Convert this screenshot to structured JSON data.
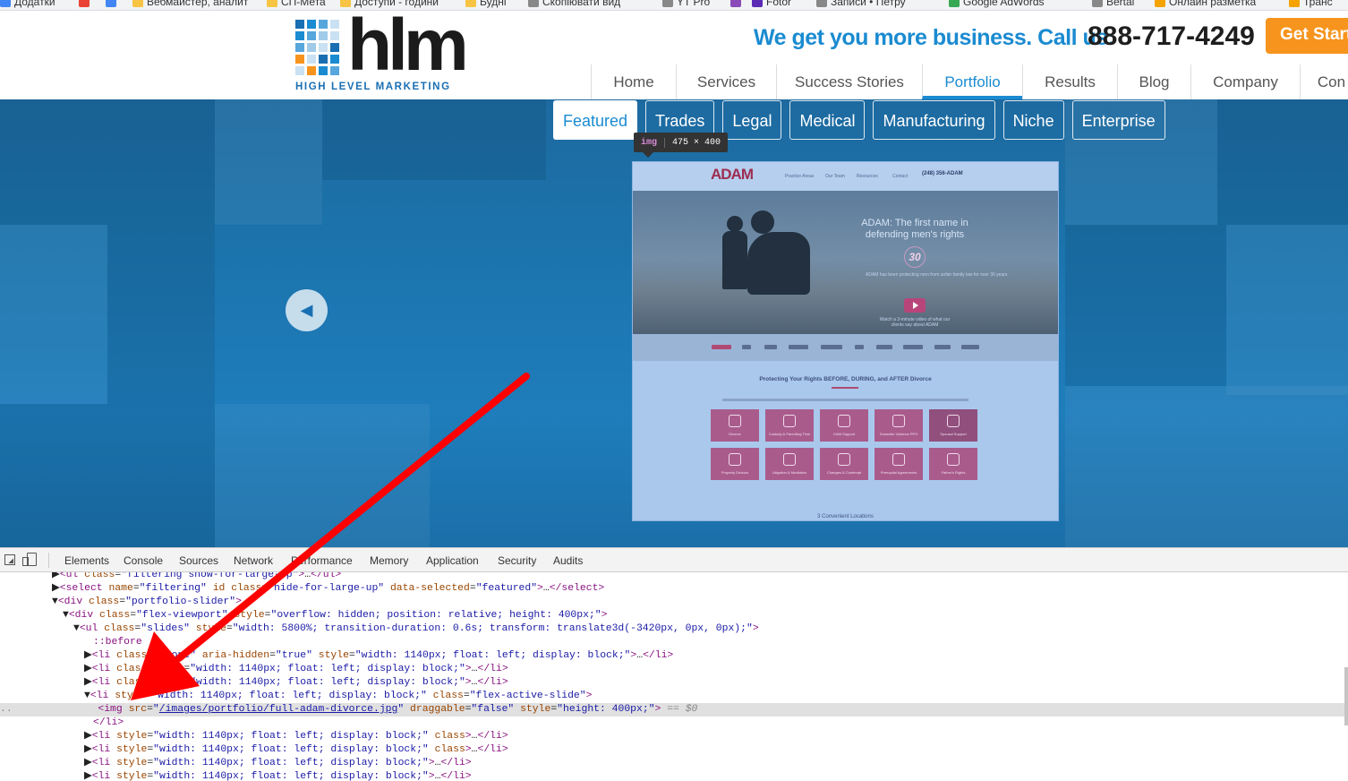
{
  "bookmarks": [
    {
      "label": "Додатки",
      "color": "#4285f4"
    },
    {
      "label": "",
      "color": "#ea4335"
    },
    {
      "label": "",
      "color": "#4285f4"
    },
    {
      "label": "Вебмайстер, аналит",
      "color": "#f7c443"
    },
    {
      "label": "СП-Мета",
      "color": "#f7c443"
    },
    {
      "label": "Доступи - години",
      "color": "#f7c443"
    },
    {
      "label": "Будні",
      "color": "#f7c443"
    },
    {
      "label": "Скопіювати вид",
      "color": "#888888"
    },
    {
      "label": "YT Pro",
      "color": "#888888"
    },
    {
      "label": "",
      "color": "#8a4ab8"
    },
    {
      "label": "Fotor",
      "color": "#5b2bb5"
    },
    {
      "label": "Записи • Петру",
      "color": "#888888"
    },
    {
      "label": "Google AdWords",
      "color": "#34a853"
    },
    {
      "label": "Bertal",
      "color": "#888888"
    },
    {
      "label": "Онлайн разметка",
      "color": "#f4a300"
    },
    {
      "label": "Транс",
      "color": "#f4a300"
    }
  ],
  "header": {
    "logo_text": "hlm",
    "logo_sub": "HIGH LEVEL MARKETING",
    "tagline": "We get you more business. Call us:",
    "phone": "888-717-4249",
    "cta": "Get Started",
    "nav": [
      "Home",
      "Services",
      "Success Stories",
      "Portfolio",
      "Results",
      "Blog",
      "Company",
      "Con"
    ],
    "active_nav": "Portfolio"
  },
  "portfolio": {
    "filters": [
      "Featured",
      "Trades",
      "Legal",
      "Medical",
      "Manufacturing",
      "Niche",
      "Enterprise"
    ],
    "active_filter": "Featured",
    "tooltip_tag": "img",
    "tooltip_dim": "475 × 400",
    "prev_glyph": "◀"
  },
  "adam_site": {
    "logo": "ADAM",
    "nav": [
      "Practice Areas",
      "Our Team",
      "Resources",
      "Contact"
    ],
    "phone": "(248) 356-ADAM",
    "hero_title": "ADAM: The first name in defending men's rights",
    "badge": "30",
    "hero_body": "ADAM has been protecting men from unfair family law for over 30 years",
    "play_caption": "Watch a 3-minute video of what our clients say about ADAM",
    "section_title": "Protecting Your Rights BEFORE, DURING, and AFTER Divorce",
    "tiles": [
      "Divorce",
      "Custody & Parenting Time",
      "Child Support",
      "Domestic Violence PPO",
      "Spousal Support",
      "Property Division",
      "Litigation & Mediation",
      "Changes & Contempt",
      "Prenuptial Agreements",
      "Father's Rights"
    ],
    "footer": "3 Convenient Locations"
  },
  "devtools": {
    "tabs": [
      "Elements",
      "Console",
      "Sources",
      "Network",
      "Performance",
      "Memory",
      "Application",
      "Security",
      "Audits"
    ]
  },
  "colors": {
    "brand_blue": "#1a8bd1",
    "cta_orange": "#f7941d",
    "hero_blue": "#1c74ad",
    "arrow_red": "#ff0000"
  }
}
